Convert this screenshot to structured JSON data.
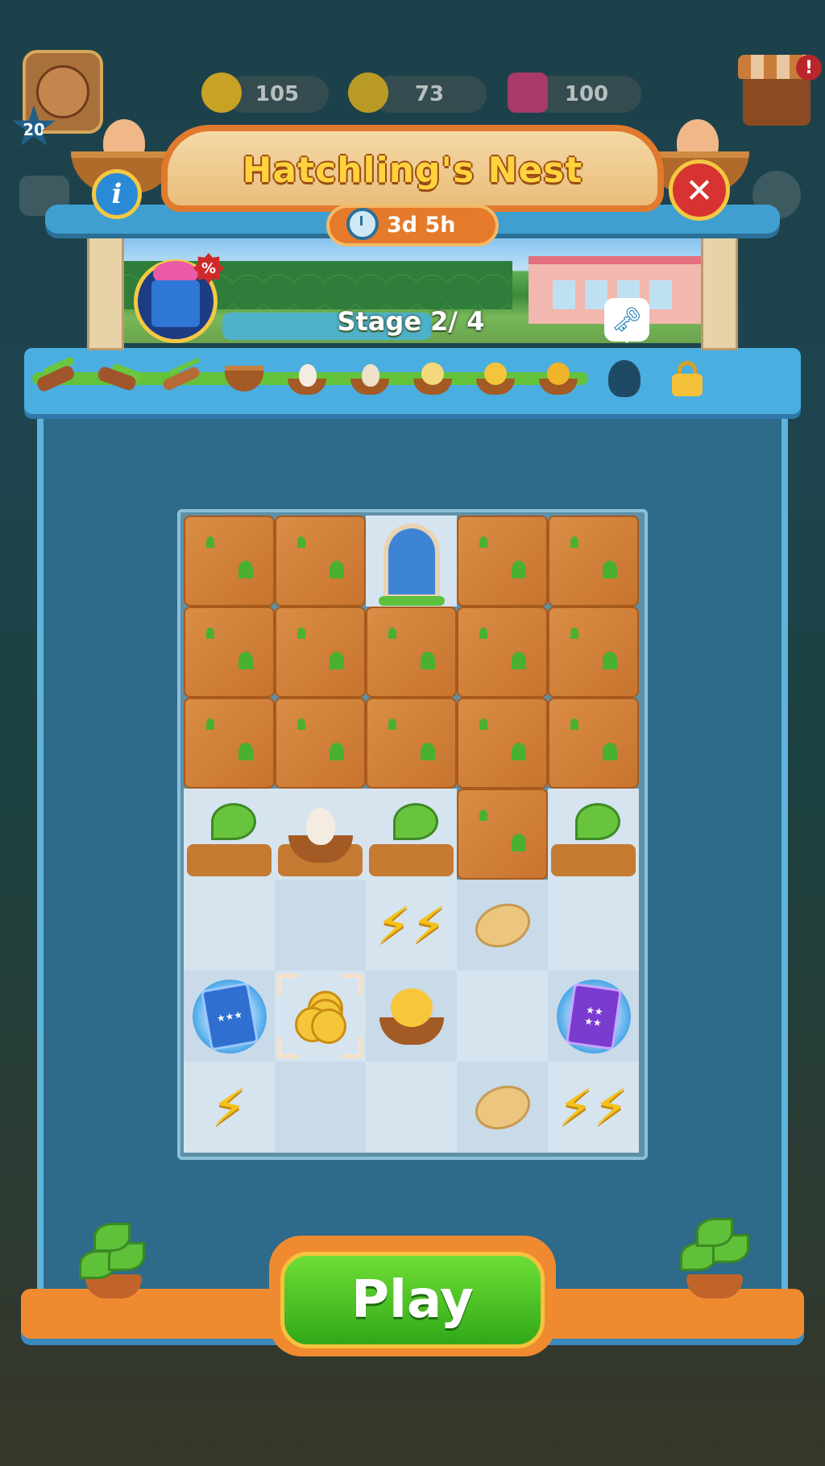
{
  "hud": {
    "player_level": "20",
    "energy": "105",
    "coins": "73",
    "gems": "100",
    "shop_alert": "!"
  },
  "event": {
    "title": "Hatchling's Nest",
    "timer": "3d 5h",
    "stage": "Stage 2/ 4",
    "info_label": "i",
    "close_label": "✕",
    "sale_badge": "%"
  },
  "progress_stages": [
    {
      "icon": "branch-icon",
      "state": "done"
    },
    {
      "icon": "branch-icon",
      "state": "done"
    },
    {
      "icon": "twig-icon",
      "state": "done"
    },
    {
      "icon": "nest-icon",
      "state": "done"
    },
    {
      "icon": "nest-egg-icon",
      "state": "done"
    },
    {
      "icon": "cracked-egg-icon",
      "state": "done"
    },
    {
      "icon": "hatching-chick-icon",
      "state": "done"
    },
    {
      "icon": "chick-icon",
      "state": "done"
    },
    {
      "icon": "grown-chick-icon",
      "state": "done"
    },
    {
      "icon": "chick-silhouette-icon",
      "state": "locked"
    },
    {
      "icon": "lock-icon",
      "state": "locked"
    }
  ],
  "board": {
    "rows": [
      [
        "dirt",
        "dirt",
        "door",
        "dirt",
        "dirt"
      ],
      [
        "dirt",
        "dirt",
        "dirt",
        "dirt",
        "dirt"
      ],
      [
        "dirt",
        "dirt",
        "dirt",
        "dirt",
        "dirt"
      ],
      [
        "stump",
        "nest-egg",
        "stump",
        "dirt",
        "stump"
      ],
      [
        "empty",
        "empty",
        "double-bolt",
        "seed",
        "empty"
      ],
      [
        "blue-card-pack",
        "coins",
        "chick-nest",
        "empty",
        "purple-card-pack"
      ],
      [
        "bolt",
        "empty",
        "empty",
        "seed",
        "double-bolt"
      ]
    ],
    "selected_cell": [
      5,
      1
    ]
  },
  "play_button": "Play",
  "colors": {
    "title_gold": "#ffd23e",
    "play_green": "#31a818",
    "panel_blue": "#2e6a8a",
    "accent_orange": "#f08a30"
  }
}
